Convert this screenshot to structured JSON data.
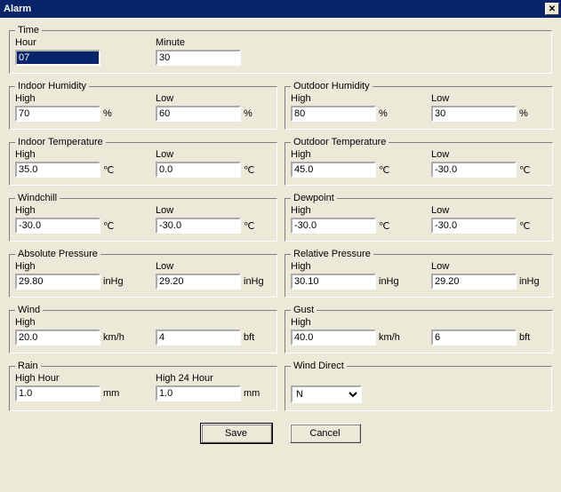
{
  "window": {
    "title": "Alarm"
  },
  "time": {
    "legend": "Time",
    "hour_label": "Hour",
    "hour_value": "07",
    "minute_label": "Minute",
    "minute_value": "30"
  },
  "indoor_humidity": {
    "legend": "Indoor Humidity",
    "high_label": "High",
    "high_value": "70",
    "high_unit": "%",
    "low_label": "Low",
    "low_value": "60",
    "low_unit": "%"
  },
  "outdoor_humidity": {
    "legend": "Outdoor Humidity",
    "high_label": "High",
    "high_value": "80",
    "high_unit": "%",
    "low_label": "Low",
    "low_value": "30",
    "low_unit": "%"
  },
  "indoor_temperature": {
    "legend": "Indoor Temperature",
    "high_label": "High",
    "high_value": "35.0",
    "high_unit": "℃",
    "low_label": "Low",
    "low_value": "0.0",
    "low_unit": "℃"
  },
  "outdoor_temperature": {
    "legend": "Outdoor Temperature",
    "high_label": "High",
    "high_value": "45.0",
    "high_unit": "℃",
    "low_label": "Low",
    "low_value": "-30.0",
    "low_unit": "℃"
  },
  "windchill": {
    "legend": "Windchill",
    "high_label": "High",
    "high_value": "-30.0",
    "high_unit": "℃",
    "low_label": "Low",
    "low_value": "-30.0",
    "low_unit": "℃"
  },
  "dewpoint": {
    "legend": "Dewpoint",
    "high_label": "High",
    "high_value": "-30.0",
    "high_unit": "℃",
    "low_label": "Low",
    "low_value": "-30.0",
    "low_unit": "℃"
  },
  "absolute_pressure": {
    "legend": "Absolute Pressure",
    "high_label": "High",
    "high_value": "29.80",
    "high_unit": "inHg",
    "low_label": "Low",
    "low_value": "29.20",
    "low_unit": "inHg"
  },
  "relative_pressure": {
    "legend": "Relative Pressure",
    "high_label": "High",
    "high_value": "30.10",
    "high_unit": "inHg",
    "low_label": "Low",
    "low_value": "29.20",
    "low_unit": "inHg"
  },
  "wind": {
    "legend": "Wind",
    "high_label": "High",
    "high_value": "20.0",
    "high_unit": "km/h",
    "bft_value": "4",
    "bft_unit": "bft"
  },
  "gust": {
    "legend": "Gust",
    "high_label": "High",
    "high_value": "40.0",
    "high_unit": "km/h",
    "bft_value": "6",
    "bft_unit": "bft"
  },
  "rain": {
    "legend": "Rain",
    "hour_label": "High    Hour",
    "hour_value": "1.0",
    "hour_unit": "mm",
    "day_label": "High    24 Hour",
    "day_value": "1.0",
    "day_unit": "mm"
  },
  "wind_direct": {
    "legend": "Wind Direct",
    "value": "N"
  },
  "buttons": {
    "save": "Save",
    "cancel": "Cancel"
  }
}
